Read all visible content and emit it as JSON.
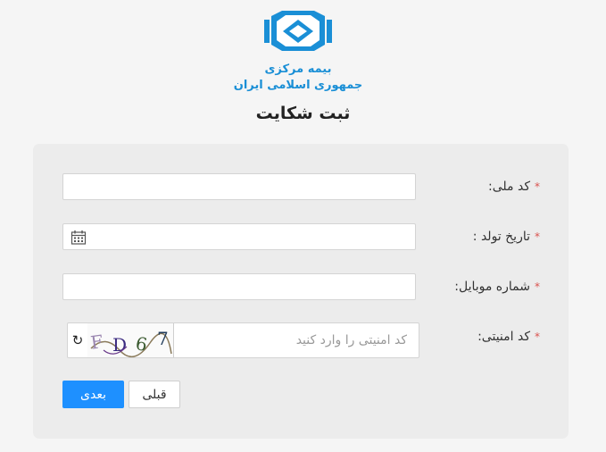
{
  "header": {
    "logo_line1": "بیمه مرکزی",
    "logo_line2": "جمهوری اسلامی ایران",
    "title": "ثبت شکایت"
  },
  "form": {
    "fields": [
      {
        "label": "کد ملی:",
        "required_mark": "*",
        "value": ""
      },
      {
        "label": "تاریخ تولد :",
        "required_mark": "*",
        "value": ""
      },
      {
        "label": "شماره موبایل:",
        "required_mark": "*",
        "value": ""
      }
    ],
    "captcha": {
      "label": "کد امنیتی:",
      "required_mark": "*",
      "placeholder": "کد امنیتی را وارد کنید",
      "image_text": "FD67",
      "refresh_icon": "refresh-icon"
    }
  },
  "buttons": {
    "next_label": "بعدی",
    "prev_label": "قبلی"
  },
  "colors": {
    "brand": "#1a8fd6",
    "primary_button": "#1e90ff",
    "required": "#d9534f",
    "panel_bg": "#ececec"
  }
}
